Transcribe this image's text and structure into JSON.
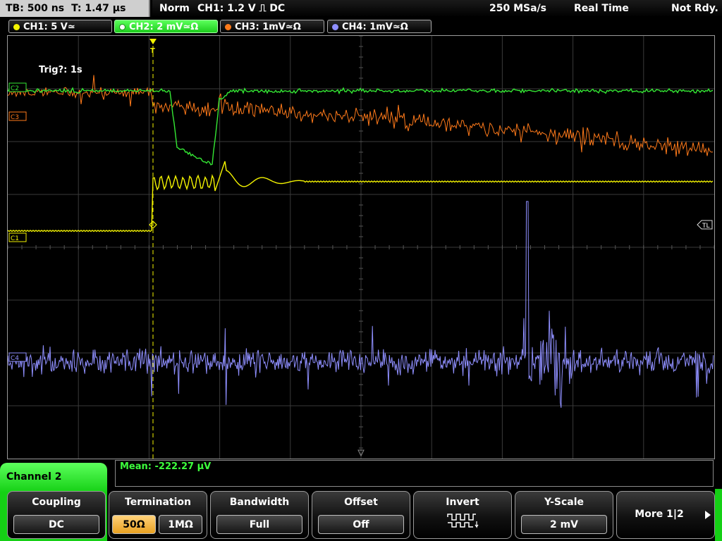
{
  "header": {
    "timebase": "TB: 500 ns",
    "trigger_time": "T: 1.47 µs",
    "mode": "Norm",
    "trigger_info": "CH1: 1.2 V ⎍ DC",
    "sample_rate": "250 MSa/s",
    "acq_mode": "Real Time",
    "status": "Not Rdy."
  },
  "channels": [
    {
      "label": "CH1: 5 V≃",
      "color": "#f4f400"
    },
    {
      "label": "CH2: 2 mV≃Ω",
      "color": "#34e834"
    },
    {
      "label": "CH3: 1mV≃Ω",
      "color": "#ff7a1a"
    },
    {
      "label": "CH4: 1mV≃Ω",
      "color": "#8f8fff"
    }
  ],
  "screen": {
    "trigger_annotation": "Trig?: 1s",
    "markers": {
      "c1": "C1",
      "c2": "C2",
      "c3": "C3",
      "c4": "C4",
      "tl": "TL",
      "trigger": "T"
    }
  },
  "measurement": {
    "mean": "Mean: -222.27 µV"
  },
  "menu": {
    "channel_label": "Channel 2",
    "coupling": {
      "title": "Coupling",
      "value": "DC"
    },
    "termination": {
      "title": "Termination",
      "opt1": "50Ω",
      "opt2": "1MΩ"
    },
    "bandwidth": {
      "title": "Bandwidth",
      "value": "Full"
    },
    "offset": {
      "title": "Offset",
      "value": "Off"
    },
    "invert": {
      "title": "Invert"
    },
    "yscale": {
      "title": "Y-Scale",
      "value": "2 mV"
    },
    "more": {
      "label": "More 1|2"
    }
  }
}
